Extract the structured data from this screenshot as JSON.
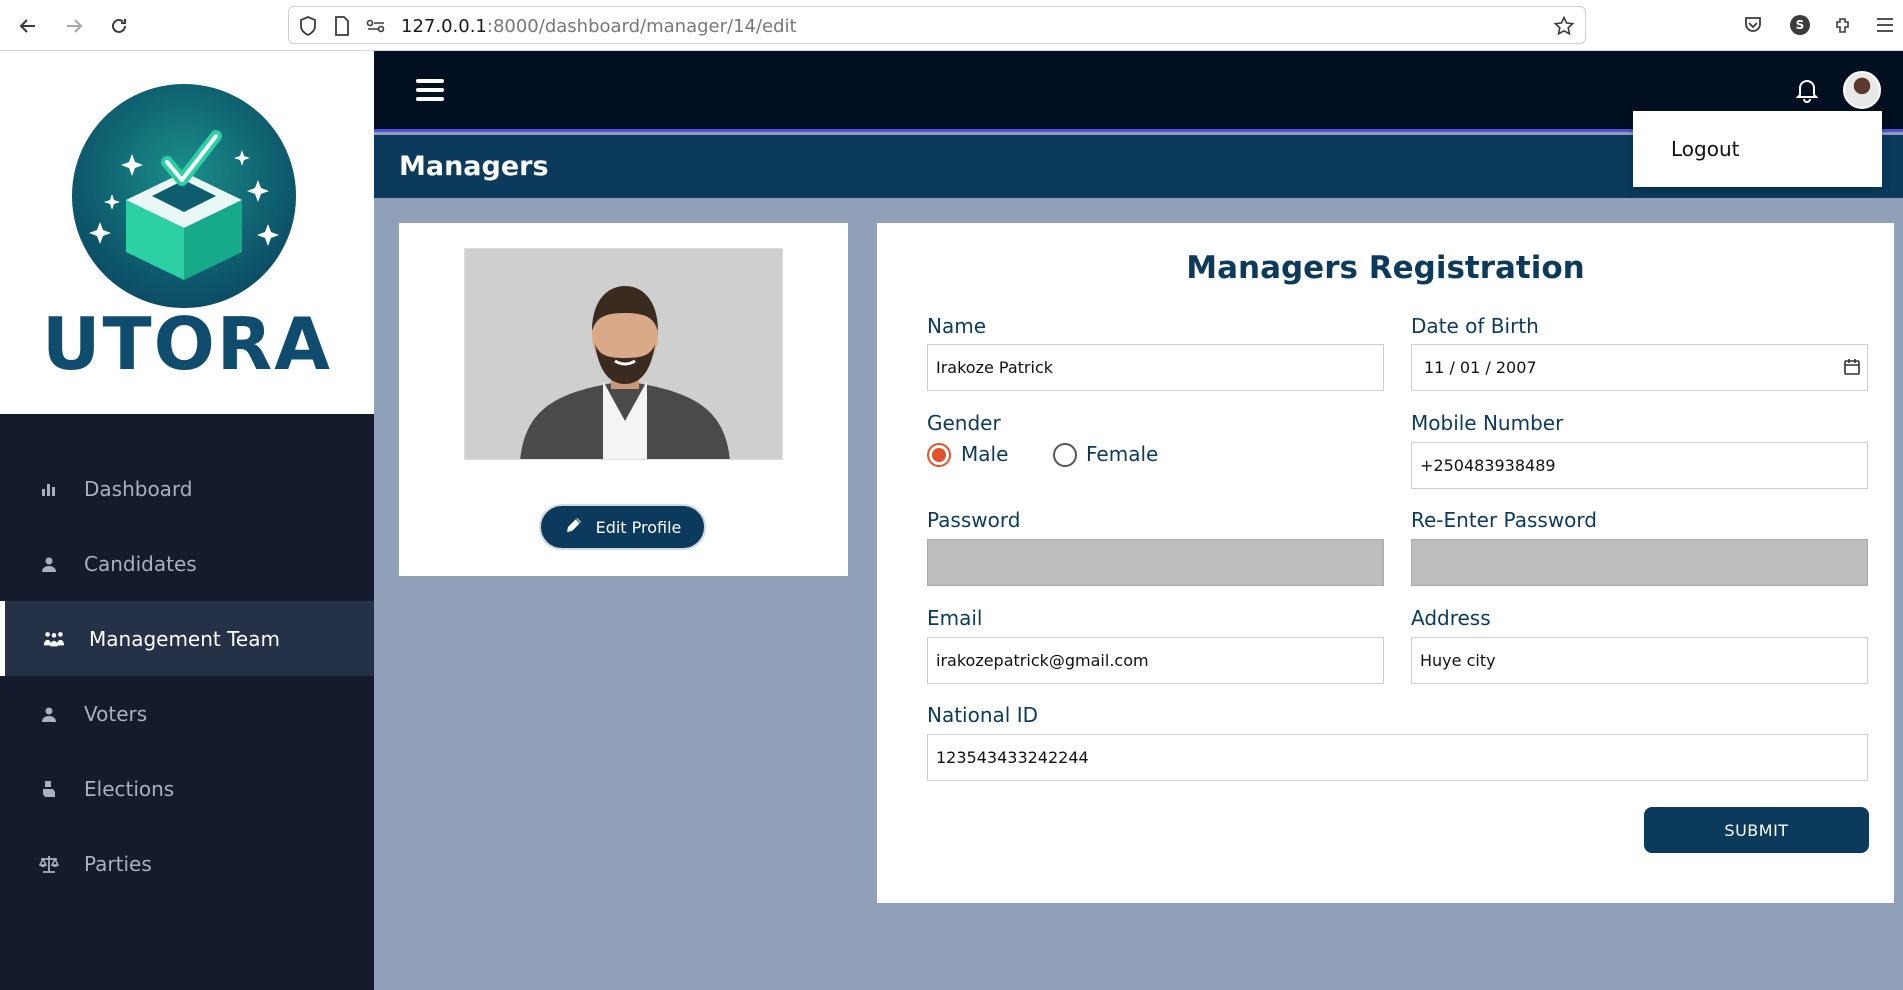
{
  "browser": {
    "url_host": "127.0.0.1",
    "url_path": ":8000/dashboard/manager/14/edit",
    "profile_initial": "S"
  },
  "brand": {
    "name": "UTORA"
  },
  "sidebar": {
    "items": [
      {
        "label": "Dashboard",
        "icon": "bar-chart-icon",
        "active": false
      },
      {
        "label": "Candidates",
        "icon": "user-icon",
        "active": false
      },
      {
        "label": "Management Team",
        "icon": "team-icon",
        "active": true
      },
      {
        "label": "Voters",
        "icon": "user-icon",
        "active": false
      },
      {
        "label": "Elections",
        "icon": "vote-hand-icon",
        "active": false
      },
      {
        "label": "Parties",
        "icon": "scale-icon",
        "active": false
      }
    ]
  },
  "header": {
    "page_title": "Managers",
    "dropdown": {
      "logout_label": "Logout"
    }
  },
  "profile": {
    "edit_label": "Edit Profile"
  },
  "form": {
    "title": "Managers Registration",
    "name_label": "Name",
    "name_value": "Irakoze Patrick",
    "dob_label": "Date of Birth",
    "dob_value": "11 / 01 / 2007",
    "gender_label": "Gender",
    "gender_male": "Male",
    "gender_female": "Female",
    "gender_selected": "Male",
    "mobile_label": "Mobile Number",
    "mobile_value": "+250483938489",
    "password_label": "Password",
    "reenter_label": "Re-Enter Password",
    "email_label": "Email",
    "email_value": "irakozepatrick@gmail.com",
    "address_label": "Address",
    "address_value": "Huye city",
    "national_id_label": "National ID",
    "national_id_value": "123543433242244",
    "submit_label": "SUBMIT"
  },
  "colors": {
    "primary": "#0b3a5c",
    "sidebar_bg": "#141b2c",
    "topbar_bg": "#020f20",
    "accent_line": "#4c53d8",
    "radio_selected": "#e0532a",
    "page_bg": "#8fa0b8"
  }
}
